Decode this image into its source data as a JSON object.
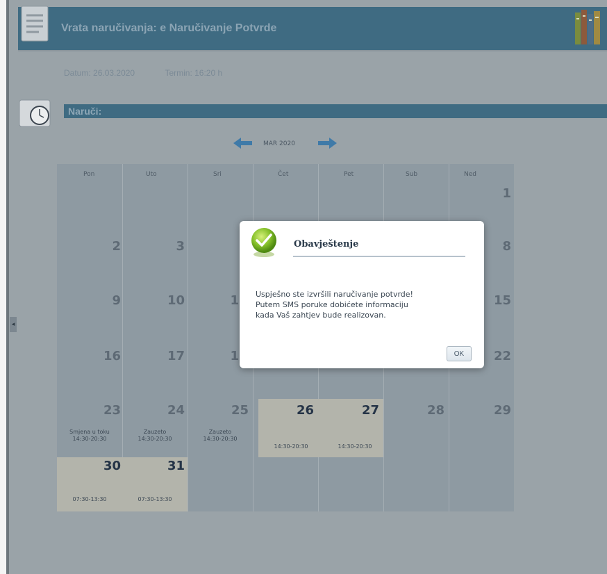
{
  "header": {
    "title": "Vrata naručivanja: e Naručivanje Potvrde"
  },
  "info": {
    "date_label": "Datum:",
    "date_value": "26.03.2020",
    "term_label": "Termin:",
    "term_value": "16:20 h"
  },
  "section": {
    "title": "Naruči:"
  },
  "calendar": {
    "month": "MAR 2020",
    "weekdays": [
      "Pon",
      "Uto",
      "Sri",
      "Čet",
      "Pet",
      "Sub",
      "Ned"
    ],
    "days": {
      "d1": "1",
      "d2": "2",
      "d3": "3",
      "d8": "8",
      "d9": "9",
      "d10": "10",
      "d11": "1",
      "d15": "15",
      "d16": "16",
      "d17": "17",
      "d18": "1",
      "d22": "22",
      "d23": "23",
      "d24": "24",
      "d25": "25",
      "d26": "26",
      "d27": "27",
      "d28": "28",
      "d29": "29",
      "d30": "30",
      "d31": "31"
    },
    "notes": {
      "d23_status": "Smjena u toku",
      "d23_time": "14:30-20:30",
      "d24_status": "Zauzeto",
      "d24_time": "14:30-20:30",
      "d25_status": "Zauzeto",
      "d25_time": "14:30-20:30",
      "d26_time": "14:30-20:30",
      "d27_time": "14:30-20:30",
      "d30_time": "07:30-13:30",
      "d31_time": "07:30-13:30"
    }
  },
  "dialog": {
    "title": "Obavještenje",
    "line1": "Uspješno ste izvršili naručivanje potvrde!",
    "line2": "Putem SMS poruke dobićete informaciju",
    "line3": "kada Vaš zahtjev bude realizovan.",
    "ok_label": "OK"
  },
  "colors": {
    "header_bar": "#3f6b82",
    "overlay": "#9aa3a8",
    "dialog_bg": "#ffffff",
    "success_green": "#7fbf2a"
  },
  "icons": {
    "header": "document-icon",
    "header_right": "books-icon",
    "section": "clock-icon",
    "prev": "arrow-left-icon",
    "next": "arrow-right-icon",
    "dialog": "checkmark-icon"
  }
}
